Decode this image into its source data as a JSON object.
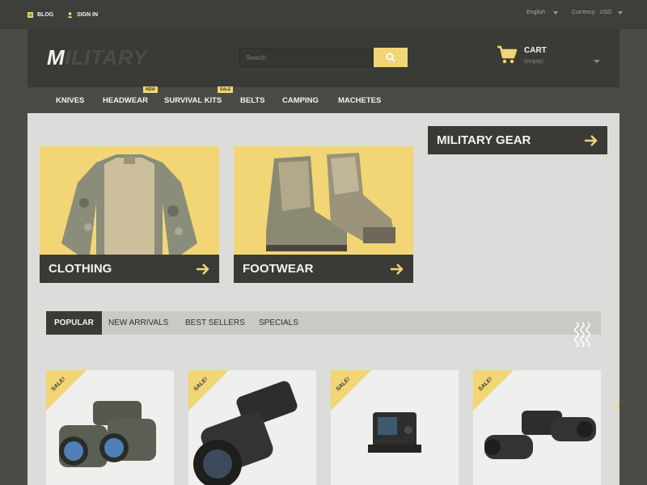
{
  "topbar": {
    "blog_label": "BLOG",
    "signin_label": "SIGN IN",
    "language": "English",
    "currency_label": "Currency:",
    "currency_value": "USD"
  },
  "header": {
    "logo_first": "M",
    "logo_rest": "ILITARY",
    "search_placeholder": "Search",
    "cart_title": "CART",
    "cart_status": "(empty)"
  },
  "nav": {
    "items": [
      {
        "label": "KNIVES",
        "badge": ""
      },
      {
        "label": "HEADWEAR",
        "badge": "NEW"
      },
      {
        "label": "SURVIVAL KITS",
        "badge": "SALE"
      },
      {
        "label": "BELTS",
        "badge": ""
      },
      {
        "label": "CAMPING",
        "badge": ""
      },
      {
        "label": "MACHETES",
        "badge": ""
      }
    ]
  },
  "categories": [
    {
      "label": "CLOTHING"
    },
    {
      "label": "FOOTWEAR"
    }
  ],
  "gear_button": "MILITARY GEAR",
  "tabs": [
    "POPULAR",
    "NEW ARRIVALS",
    "BEST SELLERS",
    "SPECIALS"
  ],
  "products": [
    {
      "sale": "SALE!"
    },
    {
      "sale": "SALE!"
    },
    {
      "sale": "SALE!"
    },
    {
      "sale": "SALE!"
    }
  ],
  "colors": {
    "accent": "#f2d675",
    "dark": "#3a3a37",
    "background": "#dcdcda"
  }
}
